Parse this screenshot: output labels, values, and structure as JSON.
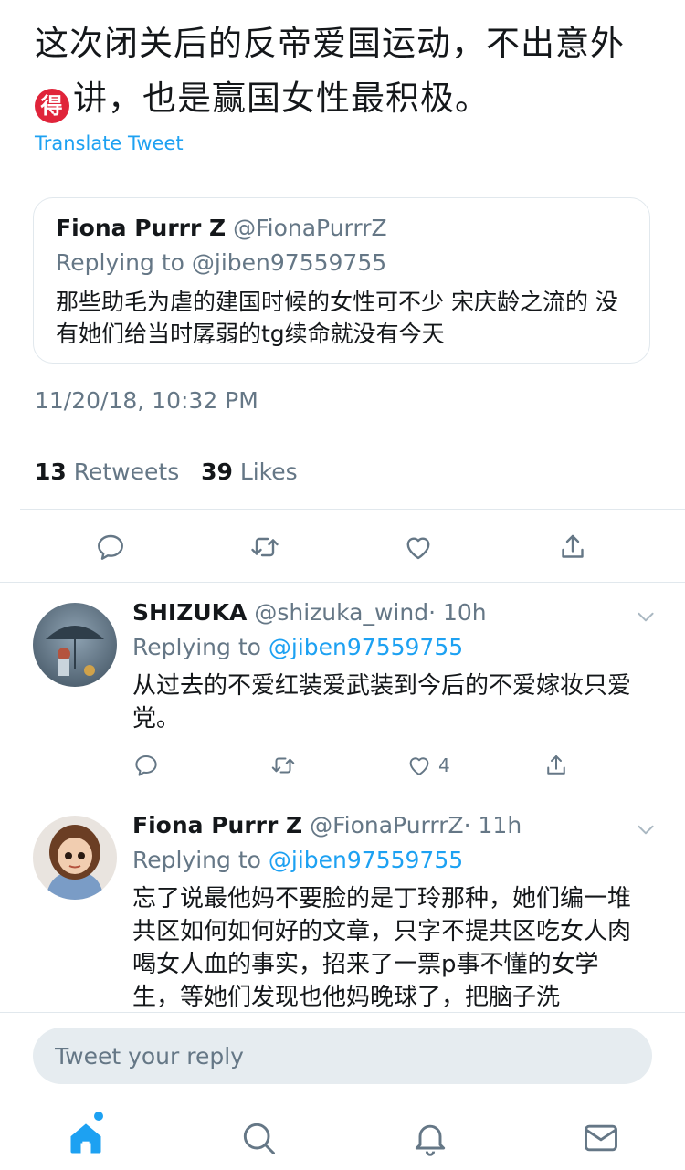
{
  "main_tweet": {
    "emoji": "得",
    "text_line1": "这次闭关后的反帝爱国运动，不出意外",
    "text_line2": "讲，也是赢国女性最积极。",
    "translate_label": "Translate Tweet",
    "timestamp": "11/20/18, 10:32 PM",
    "retweets_count": "13",
    "retweets_label": "Retweets",
    "likes_count": "39",
    "likes_label": "Likes"
  },
  "quoted_tweet": {
    "author_name": "Fiona Purrr Z",
    "author_handle": "@FionaPurrrZ",
    "replying_label": "Replying to",
    "replying_handle": "@jiben97559755",
    "text": "那些助毛为虐的建国时候的女性可不少 宋庆龄之流的 没有她们给当时孱弱的tg续命就没有今天"
  },
  "replies": [
    {
      "author_name": "SHIZUKA",
      "author_handle": "@shizuka_wind",
      "time": "· 10h",
      "replying_label": "Replying to",
      "replying_handle": "@jiben97559755",
      "text": "从过去的不爱红装爱武装到今后的不爱嫁妆只爱党。",
      "like_count": "4"
    },
    {
      "author_name": "Fiona Purrr Z",
      "author_handle": "@FionaPurrrZ",
      "time": "· 11h",
      "replying_label": "Replying to",
      "replying_handle": "@jiben97559755",
      "text": "忘了说最他妈不要脸的是丁玲那种，她们编一堆共区如何如何好的文章，只字不提共区吃女人肉喝女人血的事实，招来了一票p事不懂的女学生，等她们发现也他妈晚球了，把脑子洗"
    }
  ],
  "reply_bar": {
    "placeholder": "Tweet your reply"
  },
  "colors": {
    "accent": "#1da1f2",
    "muted": "#657786",
    "text": "#14171a",
    "divider": "#e1e8ed"
  },
  "icons": {
    "actions": [
      "reply-icon",
      "retweet-icon",
      "like-icon",
      "share-icon"
    ],
    "tabs": [
      "home-icon",
      "search-icon",
      "notifications-icon",
      "messages-icon"
    ]
  }
}
